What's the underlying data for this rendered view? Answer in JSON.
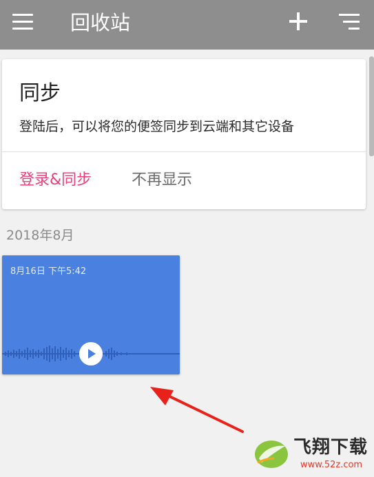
{
  "appbar": {
    "title": "回收站",
    "menu_icon": "menu-icon",
    "add_icon": "add-icon",
    "sort_icon": "sort-icon",
    "background": "#8e8e8e"
  },
  "sync_card": {
    "title": "同步",
    "description": "登陆后，可以将您的便签同步到云端和其它设备",
    "login_label": "登录&同步",
    "dismiss_label": "不再显示",
    "accent": "#ec407a"
  },
  "notes": {
    "month_header": "2018年8月",
    "items": [
      {
        "date": "8月16日 下午5:42",
        "type": "voice",
        "color": "#4a80e0",
        "play_icon": "play-icon"
      }
    ]
  },
  "annotation": {
    "arrow_color": "#e8211a"
  },
  "watermark": {
    "brand": "飞翔下载",
    "url": "www.52z.com"
  }
}
